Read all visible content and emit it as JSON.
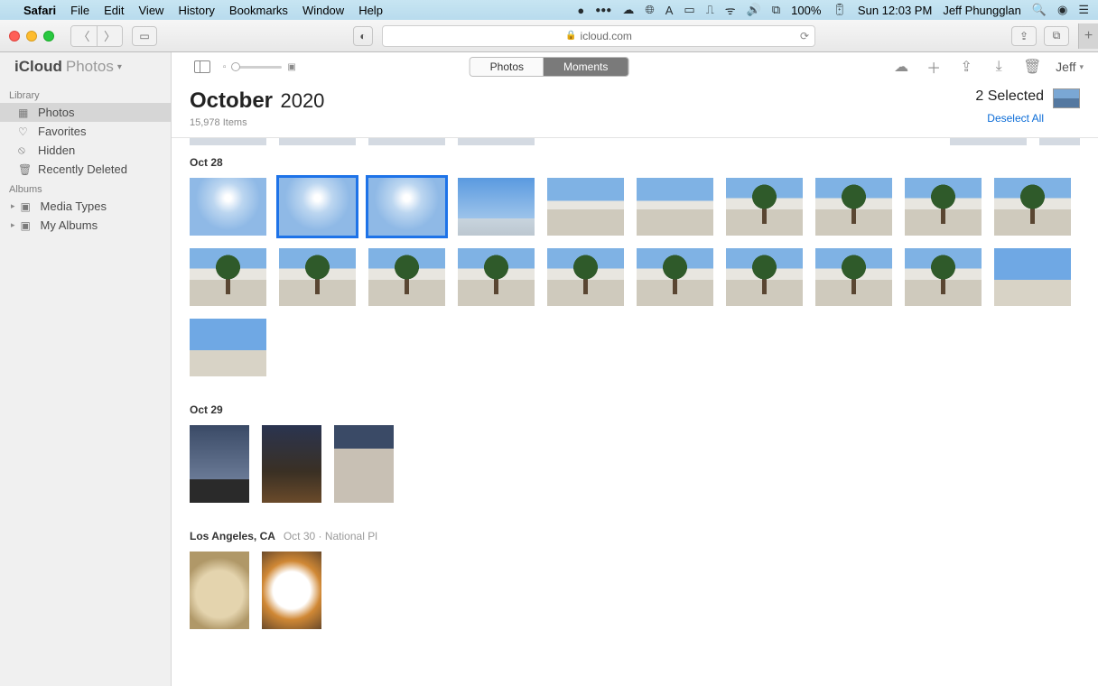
{
  "menubar": {
    "app": "Safari",
    "items": [
      "File",
      "Edit",
      "View",
      "History",
      "Bookmarks",
      "Window",
      "Help"
    ],
    "battery": "100%",
    "clock": "Sun 12:03 PM",
    "user": "Jeff Phungglan"
  },
  "safari": {
    "url": "icloud.com"
  },
  "app": {
    "brand_icloud": "iCloud",
    "brand_photos": "Photos",
    "segments": {
      "photos": "Photos",
      "moments": "Moments"
    },
    "user_menu": "Jeff"
  },
  "sidebar": {
    "section_library": "Library",
    "section_albums": "Albums",
    "library": [
      {
        "icon": "photos-icon",
        "label": "Photos",
        "selected": true
      },
      {
        "icon": "heart-icon",
        "label": "Favorites",
        "selected": false
      },
      {
        "icon": "hidden-icon",
        "label": "Hidden",
        "selected": false
      },
      {
        "icon": "trash-icon",
        "label": "Recently Deleted",
        "selected": false
      }
    ],
    "albums": [
      {
        "label": "Media Types"
      },
      {
        "label": "My Albums"
      }
    ]
  },
  "header": {
    "month": "October",
    "year": "2020",
    "count": "15,978 Items",
    "selected": "2 Selected",
    "deselect": "Deselect All"
  },
  "sections": {
    "s1": {
      "title": "Oct 28"
    },
    "s2": {
      "title": "Oct 29"
    },
    "s3": {
      "title": "Los Angeles, CA",
      "sub": "Oct 30   ·   National Pl"
    }
  }
}
